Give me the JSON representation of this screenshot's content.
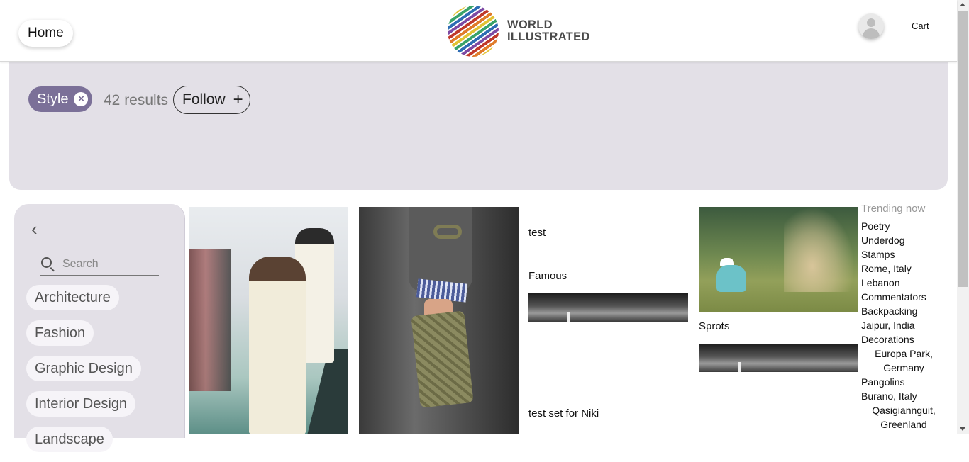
{
  "header": {
    "home_label": "Home",
    "logo_line1": "WORLD",
    "logo_line2": "ILLUSTRATED",
    "cart_label": "Cart"
  },
  "hero": {
    "tag_label": "Style",
    "tag_remove_glyph": "×",
    "results_text": "42 results",
    "follow_label": "Follow",
    "follow_glyph": "+"
  },
  "sidebar": {
    "back_glyph": "‹",
    "search_placeholder": "Search",
    "categories": [
      "Architecture",
      "Fashion",
      "Graphic Design",
      "Interior Design",
      "Landscape"
    ]
  },
  "grid": {
    "col3_titles": [
      "test",
      "Famous",
      "test set for Niki"
    ],
    "col4_title": "Sprots"
  },
  "trending": {
    "title": "Trending now",
    "items": [
      "Poetry",
      "Underdog",
      "Stamps",
      "Rome, Italy",
      "Lebanon",
      "Commentators",
      "Backpacking",
      "Jaipur, India",
      "Decorations",
      "Europa Park, Germany",
      "Pangolins",
      "Burano, Italy",
      "Qasigiannguit, Greenland"
    ]
  },
  "icons": {
    "avatar": "user-avatar-icon",
    "search": "search-icon",
    "back": "chevron-left-icon",
    "remove": "close-circle-icon",
    "follow": "plus-icon"
  },
  "colors": {
    "hero_bg": "#e3e0e7",
    "tag_bg": "#7b7098",
    "chip_bg": "#f6f4f8"
  }
}
